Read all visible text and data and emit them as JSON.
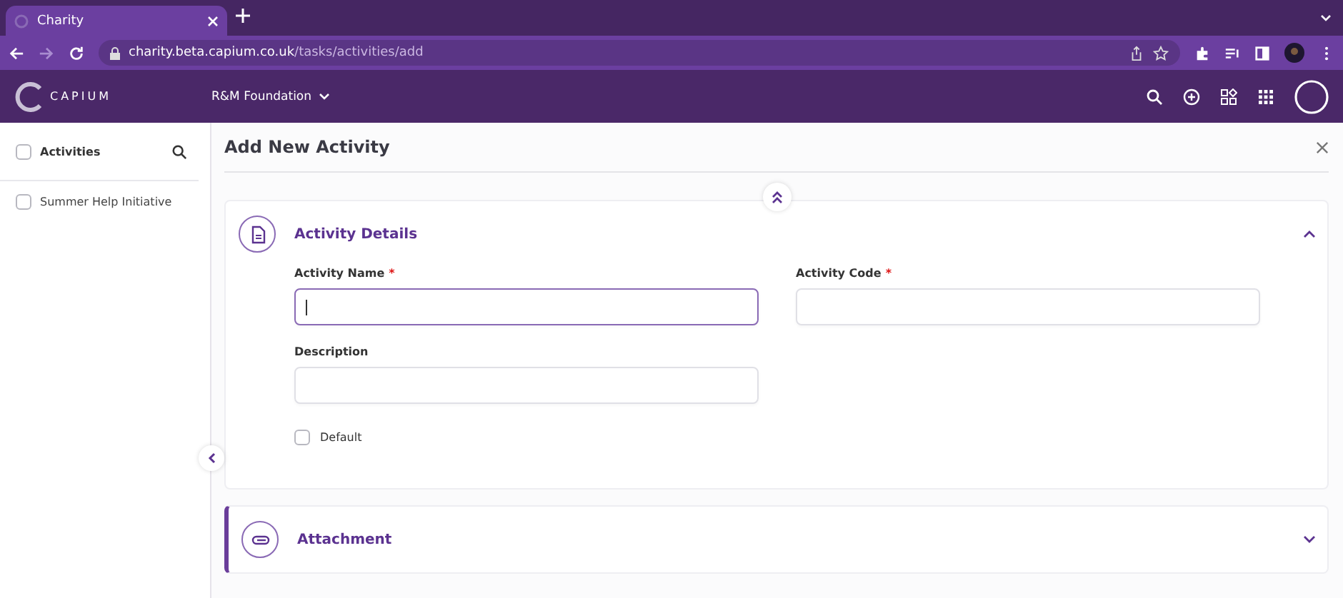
{
  "browser": {
    "tab": {
      "title": "Charity"
    },
    "url_host": "charity.beta.capium.co.uk",
    "url_path": "/tasks/activities/add"
  },
  "app_header": {
    "logo": "CAPIUM",
    "organisation": "R&M Foundation"
  },
  "sidebar": {
    "header": {
      "label": "Activities",
      "checked": false
    },
    "items": [
      {
        "label": "Summer Help Initiative",
        "checked": false
      }
    ]
  },
  "page": {
    "title": "Add New Activity"
  },
  "sections": [
    {
      "title": "Activity Details",
      "kind": "details",
      "expanded": true,
      "fields": [
        {
          "kind": "text",
          "label": "Activity Name",
          "required_mark": "*",
          "focused": true
        },
        {
          "kind": "text",
          "label": "Activity Code",
          "required_mark": "*",
          "focused": false
        },
        {
          "kind": "text",
          "label": "Description",
          "focused": false
        },
        {
          "kind": "checkbox",
          "label": "Default",
          "checked": false
        }
      ]
    },
    {
      "title": "Attachment",
      "kind": "attachment",
      "expanded": false
    }
  ]
}
